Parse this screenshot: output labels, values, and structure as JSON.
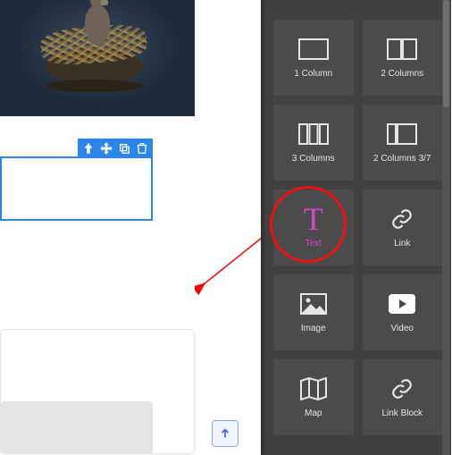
{
  "toolbar": {
    "move_parent": "Move to parent",
    "move": "Move",
    "duplicate": "Duplicate",
    "delete": "Delete"
  },
  "scroll_top_label": "Scroll to top",
  "panel": {
    "blocks": {
      "col1": "1 Column",
      "col2": "2 Columns",
      "col3": "3 Columns",
      "col2_37": "2 Columns 3/7",
      "text": "Text",
      "link": "Link",
      "image": "Image",
      "video": "Video",
      "map": "Map",
      "link_block": "Link Block"
    }
  }
}
